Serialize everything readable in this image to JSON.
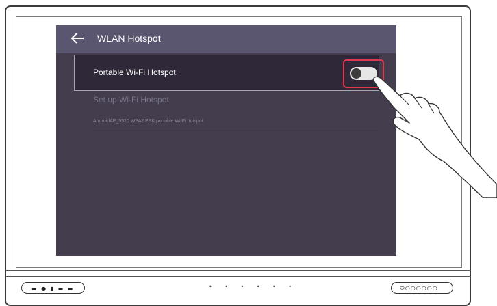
{
  "header": {
    "title": "WLAN Hotspot",
    "back_icon": "back-arrow-icon"
  },
  "hotspot_row": {
    "label": "Portable Wi-Fi Hotspot",
    "toggle_state": "off"
  },
  "setup": {
    "label": "Set up Wi-Fi Hotspot",
    "description": "AndroidAP_5520 WPA2 PSK portable Wi-Fi hotspot"
  },
  "colors": {
    "screen_bg": "#433d4d",
    "header_bg": "#5b5670",
    "highlight": "#e03a4a"
  }
}
